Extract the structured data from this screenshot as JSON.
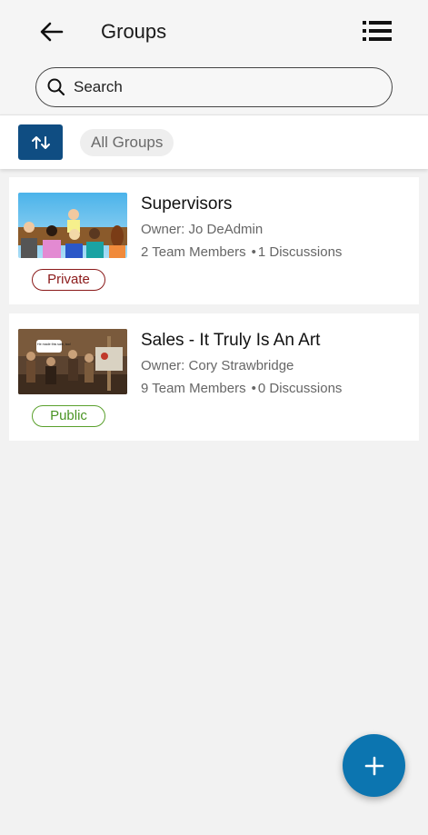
{
  "header": {
    "title": "Groups",
    "back_icon": "arrow-left-icon",
    "menu_icon": "list-icon"
  },
  "search": {
    "placeholder": "Search",
    "icon": "search-icon"
  },
  "toolbar": {
    "sort_icon": "sort-arrows-icon",
    "filter_label": "All Groups"
  },
  "groups": [
    {
      "title": "Supervisors",
      "owner": "Owner: Jo DeAdmin",
      "members": "2 Team Members",
      "separator": "•",
      "discussions": "1 Discussions",
      "visibility": "Private"
    },
    {
      "title": "Sales - It Truly Is An Art",
      "owner": "Owner: Cory Strawbridge",
      "members": "9 Team Members",
      "separator": "•",
      "discussions": "0 Discussions",
      "visibility": "Public",
      "thumb_caption": "He made this sale, too!"
    }
  ],
  "fab": {
    "icon": "plus-icon"
  },
  "colors": {
    "primary": "#0f4d82",
    "fab": "#0c75b0",
    "private": "#8b1a1a",
    "public": "#4a9423"
  }
}
